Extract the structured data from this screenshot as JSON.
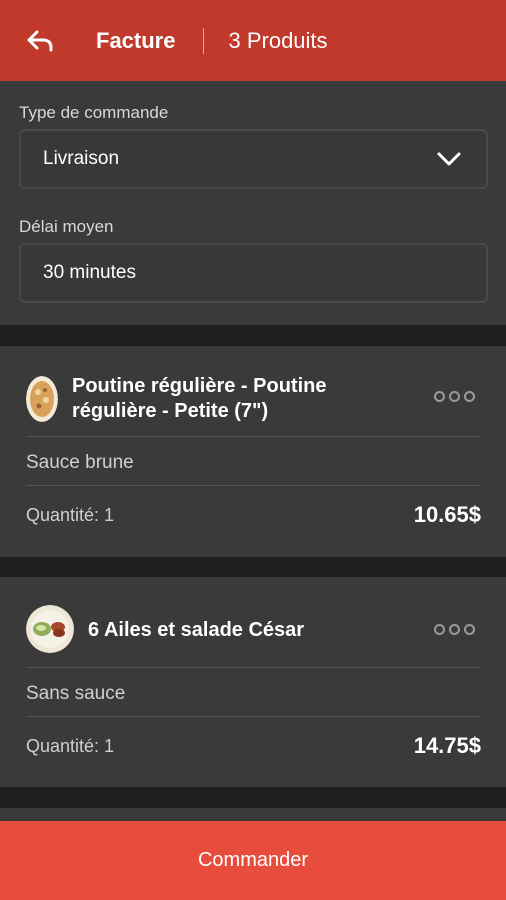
{
  "header": {
    "title": "Facture",
    "product_count": "3 Produits",
    "back_icon": "back-arrow-icon",
    "color": "#c0392b"
  },
  "form": {
    "order_type_label": "Type de commande",
    "order_type_value": "Livraison",
    "delay_label": "Délai moyen",
    "delay_value": "30 minutes"
  },
  "items": [
    {
      "title": "Poutine régulière - Poutine régulière - Petite (7\")",
      "option": "Sauce brune",
      "quantity": "Quantité: 1",
      "price": "10.65$"
    },
    {
      "title": "6 Ailes et salade César",
      "option": "Sans sauce",
      "quantity": "Quantité: 1",
      "price": "14.75$"
    }
  ],
  "footer": {
    "order_label": "Commander",
    "color": "#e74c3c"
  }
}
